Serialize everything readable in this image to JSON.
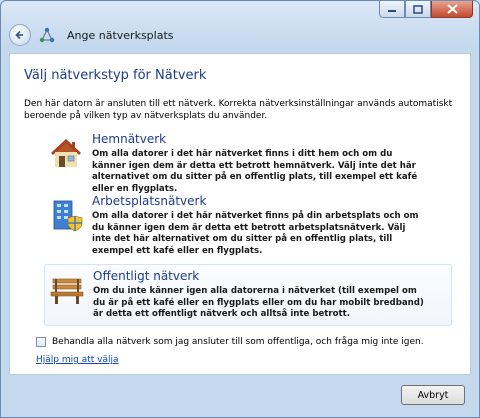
{
  "window": {
    "title": "Ange nätverksplats"
  },
  "page": {
    "heading": "Välj nätverkstyp för Nätverk",
    "description": "Den här datorn är ansluten till ett nätverk. Korrekta nätverksinställningar används automatiskt beroende på vilken typ av nätverksplats du använder."
  },
  "options": [
    {
      "title": "Hemnätverk",
      "description": "Om alla datorer i det här nätverket finns i ditt hem och om du känner igen dem är detta ett betrott hemnätverk. Välj inte det här alternativet om du sitter på en offentlig plats, till exempel ett kafé eller en flygplats.",
      "icon": "house-icon"
    },
    {
      "title": "Arbetsplatsnätverk",
      "description": "Om alla datorer i det här nätverket finns på din arbetsplats och om du känner igen dem är detta ett betrott arbetsplatsnätverk. Välj inte det här alternativet om du sitter på en offentlig plats, till exempel ett kafé eller en flygplats.",
      "icon": "office-building-icon"
    },
    {
      "title": "Offentligt nätverk",
      "description": "Om du inte känner igen alla datorerna i nätverket (till exempel om du är på ett kafé eller en flygplats eller om du har mobilt bredband) är detta ett offentligt nätverk och alltså inte betrott.",
      "icon": "park-bench-icon"
    }
  ],
  "checkbox": {
    "label": "Behandla alla nätverk som jag ansluter till som offentliga, och fråga mig inte igen.",
    "checked": false
  },
  "help_link": "Hjälp mig att välja",
  "buttons": {
    "cancel": "Avbryt"
  },
  "colors": {
    "accent": "#1e3c8c",
    "link": "#0f47c9"
  }
}
